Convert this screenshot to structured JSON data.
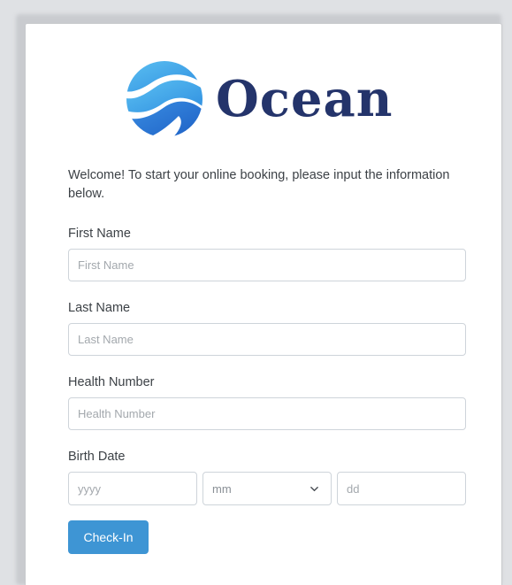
{
  "brand": {
    "name": "Ocean",
    "colors": {
      "primary": "#24346b",
      "accent": "#3e95d4",
      "logo_light": "#4fb6ee"
    },
    "logo_icon": "ocean-wave-globe-icon"
  },
  "intro": {
    "text": "Welcome! To start your online booking, please input the information below."
  },
  "form": {
    "first_name": {
      "label": "First Name",
      "placeholder": "First Name",
      "value": ""
    },
    "last_name": {
      "label": "Last Name",
      "placeholder": "Last Name",
      "value": ""
    },
    "health_number": {
      "label": "Health Number",
      "placeholder": "Health Number",
      "value": ""
    },
    "birth_date": {
      "label": "Birth Date",
      "year_placeholder": "yyyy",
      "month_selected": "mm",
      "day_placeholder": "dd"
    },
    "submit_label": "Check-In"
  }
}
